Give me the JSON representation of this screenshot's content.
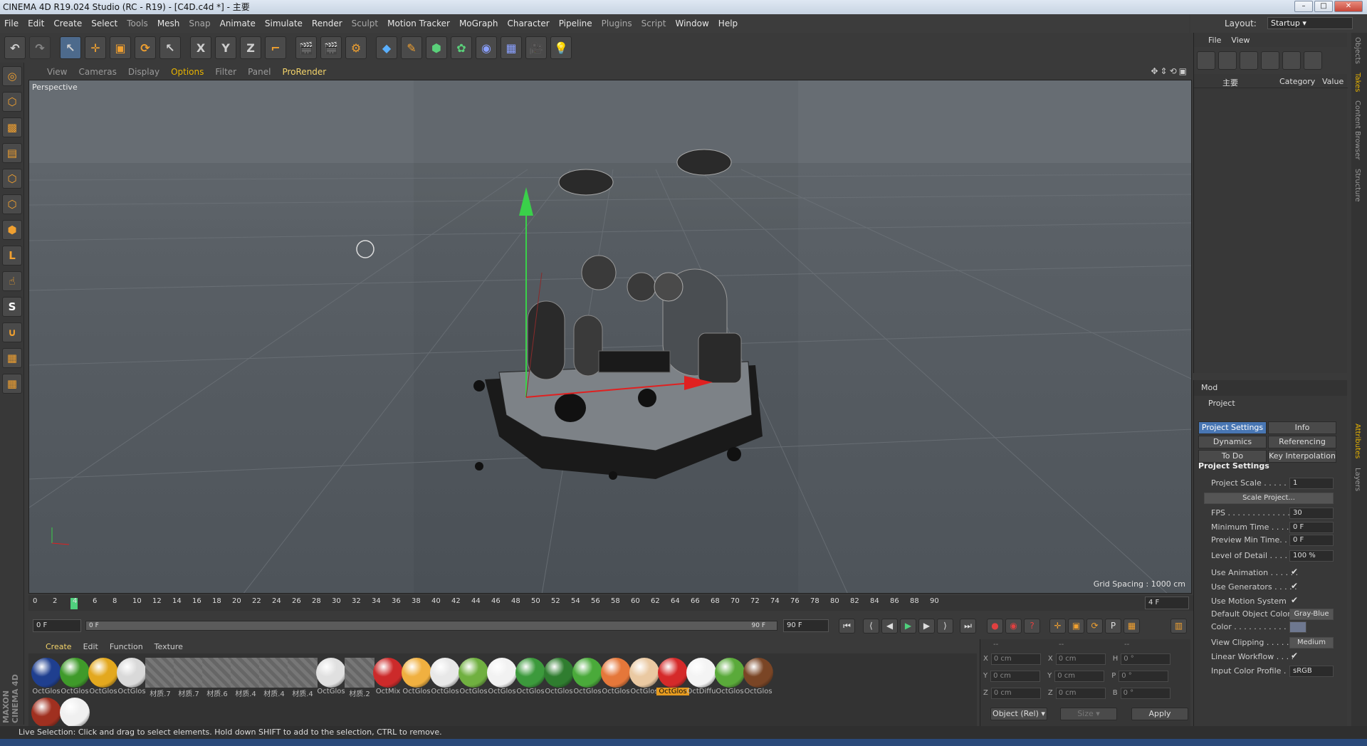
{
  "window": {
    "title": "CINEMA 4D R19.024 Studio (RC - R19) - [C4D.c4d *] - 主要"
  },
  "menu": [
    "File",
    "Edit",
    "Create",
    "Select",
    "Tools",
    "Mesh",
    "Snap",
    "Animate",
    "Simulate",
    "Render",
    "Sculpt",
    "Motion Tracker",
    "MoGraph",
    "Character",
    "Pipeline",
    "Plugins",
    "Script",
    "Window",
    "Help"
  ],
  "layout": {
    "label": "Layout:",
    "value": "Startup"
  },
  "viewport": {
    "menu": [
      "View",
      "Cameras",
      "Display",
      "Options",
      "Filter",
      "Panel",
      "ProRender"
    ],
    "active_menu": "Options",
    "name": "Perspective",
    "grid_spacing": "Grid Spacing : 1000 cm"
  },
  "timeline": {
    "ticks": [
      "0",
      "2",
      "4",
      "6",
      "8",
      "10",
      "12",
      "14",
      "16",
      "18",
      "20",
      "22",
      "24",
      "26",
      "28",
      "30",
      "32",
      "34",
      "36",
      "38",
      "40",
      "42",
      "44",
      "46",
      "48",
      "50",
      "52",
      "54",
      "56",
      "58",
      "60",
      "62",
      "64",
      "66",
      "68",
      "70",
      "72",
      "74",
      "76",
      "78",
      "80",
      "82",
      "84",
      "86",
      "88",
      "90"
    ],
    "current_frame": "4 F",
    "start": "0 F",
    "slider_start": "0 F",
    "slider_end": "90 F",
    "end": "90 F"
  },
  "materials": {
    "tabs": [
      "Create",
      "Edit",
      "Function",
      "Texture"
    ],
    "items": [
      {
        "name": "OctGlos",
        "color": "#1f3f8f"
      },
      {
        "name": "OctGlos",
        "color": "#3f9a2a"
      },
      {
        "name": "OctGlos",
        "color": "#e3a81e"
      },
      {
        "name": "OctGlos",
        "color": "#d9d9d9"
      },
      {
        "name": "材质.7",
        "color": "#6a6a6a"
      },
      {
        "name": "材质.7",
        "color": "#6a6a6a"
      },
      {
        "name": "材质.6",
        "color": "#6a6a6a"
      },
      {
        "name": "材质.4",
        "color": "#6a6a6a"
      },
      {
        "name": "材质.4",
        "color": "#6a6a6a"
      },
      {
        "name": "材质.4",
        "color": "#6a6a6a"
      },
      {
        "name": "OctGlos",
        "color": "#e0e0e0"
      },
      {
        "name": "材质.2",
        "color": "#d49a64"
      },
      {
        "name": "OctMix",
        "color": "#cc2a2a"
      },
      {
        "name": "OctGlos",
        "color": "#f0b040"
      },
      {
        "name": "OctGlos",
        "color": "#e8e8e8"
      },
      {
        "name": "OctGlos",
        "color": "#70b040"
      },
      {
        "name": "OctGlos",
        "color": "#f2f2f2"
      },
      {
        "name": "OctGlos",
        "color": "#3c9a3c"
      },
      {
        "name": "OctGlos",
        "color": "#2f7d2f"
      },
      {
        "name": "OctGlos",
        "color": "#4aaa3a"
      },
      {
        "name": "OctGlos",
        "color": "#e5773a"
      },
      {
        "name": "OctGlos",
        "color": "#eac9a2"
      },
      {
        "name": "OctGlos",
        "color": "#d52a2a"
      },
      {
        "name": "OctDiffu",
        "color": "#f4f4f4"
      },
      {
        "name": "OctGlos",
        "color": "#5aaa3a"
      },
      {
        "name": "OctGlos",
        "color": "#7a4525"
      },
      {
        "name": "",
        "color": "#a03020"
      },
      {
        "name": "",
        "color": "#f0f0f0"
      }
    ],
    "selected_index": 22
  },
  "coords": {
    "headers": [
      "--",
      "--",
      "--"
    ],
    "rows": [
      {
        "a": "X",
        "av": "0 cm",
        "b": "X",
        "bv": "0 cm",
        "c": "H",
        "cv": "0 °"
      },
      {
        "a": "Y",
        "av": "0 cm",
        "b": "Y",
        "bv": "0 cm",
        "c": "P",
        "cv": "0 °"
      },
      {
        "a": "Z",
        "av": "0 cm",
        "b": "Z",
        "bv": "0 cm",
        "c": "B",
        "cv": "0 °"
      }
    ],
    "mode": "Object (Rel)",
    "size": "Size",
    "apply": "Apply"
  },
  "objects": {
    "menu": [
      "File",
      "View"
    ],
    "columns": {
      "name": "主要",
      "category": "Category",
      "value": "Value"
    }
  },
  "attributes": {
    "mode": "Mod",
    "object": "Project",
    "tabs": [
      "Project Settings",
      "Info",
      "Dynamics",
      "Referencing",
      "To Do",
      "Key Interpolation"
    ],
    "section": "Project Settings",
    "rows": [
      {
        "label": "Project Scale . . . . . . .",
        "value": "1"
      },
      {
        "label": "FPS . . . . . . . . . . . . . . .",
        "value": "30"
      },
      {
        "label": "Minimum Time . . . . . .",
        "value": "0 F"
      },
      {
        "label": "Preview Min Time. . . .",
        "value": "0 F"
      },
      {
        "label": "Level of Detail . . . . . .",
        "value": "100 %"
      },
      {
        "label": "Default Object Color",
        "value": "Gray-Blue"
      },
      {
        "label": "Color . . . . . . . . . . .",
        "value": ""
      },
      {
        "label": "View Clipping . . . . . .",
        "value": "Medium"
      },
      {
        "label": "Input Color Profile . .",
        "value": "sRGB"
      }
    ],
    "checks": [
      {
        "label": "Use Animation . . . . . .",
        "value": "✔"
      },
      {
        "label": "Use Generators . . . . .",
        "value": "✔"
      },
      {
        "label": "Use Motion System",
        "value": "✔"
      },
      {
        "label": "Linear Workflow . . . .",
        "value": "✔"
      }
    ],
    "scale_btn": "Scale Project..."
  },
  "side_tabs": [
    "Objects",
    "Takes",
    "Content Browser",
    "Structure",
    "Attributes",
    "Layers"
  ],
  "status": "Live Selection: Click and drag to select elements. Hold down SHIFT to add to the selection, CTRL to remove.",
  "brand": "MAXON CINEMA 4D"
}
